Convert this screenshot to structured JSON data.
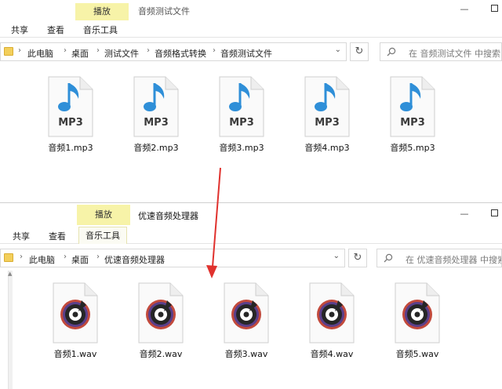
{
  "top_window": {
    "context_tab": "播放",
    "title": "音频测试文件",
    "ribbon_tabs": [
      "共享",
      "查看",
      "音乐工具"
    ],
    "breadcrumb": [
      "此电脑",
      "桌面",
      "测试文件",
      "音频格式转换",
      "音频测试文件"
    ],
    "search_placeholder": "在 音频测试文件 中搜索",
    "files": [
      {
        "name": "音频1.mp3",
        "badge": "MP3"
      },
      {
        "name": "音频2.mp3",
        "badge": "MP3"
      },
      {
        "name": "音频3.mp3",
        "badge": "MP3"
      },
      {
        "name": "音频4.mp3",
        "badge": "MP3"
      },
      {
        "name": "音频5.mp3",
        "badge": "MP3"
      }
    ]
  },
  "bottom_window": {
    "context_tab": "播放",
    "title": "优速音频处理器",
    "ribbon_tabs": [
      "共享",
      "查看",
      "音乐工具"
    ],
    "breadcrumb": [
      "此电脑",
      "桌面",
      "优速音频处理器"
    ],
    "search_placeholder": "在 优速音频处理器 中搜索",
    "files": [
      {
        "name": "音频1.wav"
      },
      {
        "name": "音频2.wav"
      },
      {
        "name": "音频3.wav"
      },
      {
        "name": "音频4.wav"
      },
      {
        "name": "音频5.wav"
      }
    ]
  },
  "icons": {
    "mp3_note_color": "#2f8fd8",
    "badge_text_color": "#3b3b3b",
    "arrow_color": "#e0322e",
    "folder_color": "#f3cf5b",
    "context_tab_color": "#f7f3a8"
  }
}
